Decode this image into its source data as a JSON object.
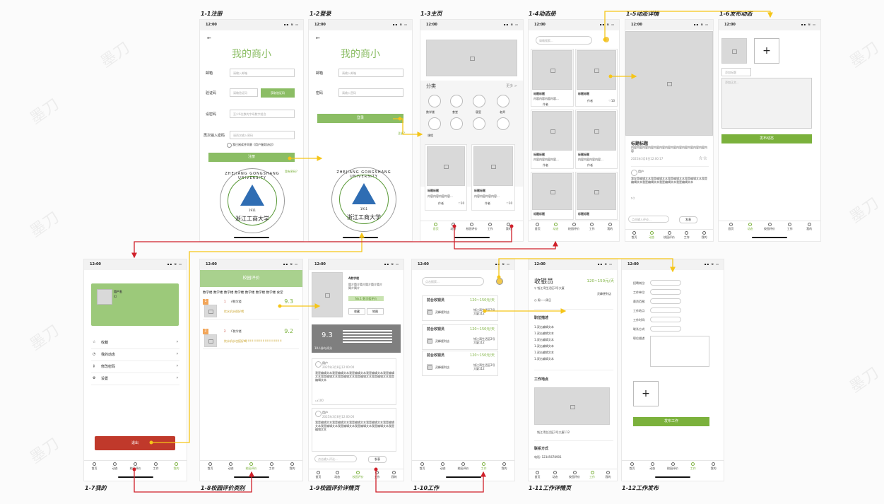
{
  "status_time": "12:00",
  "status_icons": "▪▪ ≋ ▭",
  "titles": {
    "s1": "1-1注册",
    "s2": "1-2登录",
    "s3": "1-3主页",
    "s4": "1-4动态册",
    "s5": "1-5动态详情",
    "s6": "1-6发布动态",
    "s7": "1-7我的",
    "s8": "1-8校园评价类别",
    "s9": "1-9校园评价详情页",
    "s10": "1-10工作",
    "s11": "1-11工作详情页",
    "s12": "1-12工作发布"
  },
  "tabs": [
    "首页",
    "动态",
    "校园评价",
    "工作",
    "我的"
  ],
  "register": {
    "brand": "我的商小",
    "email_label": "邮箱",
    "email_ph": "请输入邮箱",
    "code_label": "验证码",
    "code_ph": "请输验证码",
    "code_btn": "获取验证码",
    "pwd_label": "设密码",
    "pwd_ph": "至少6位数的字母数字组合",
    "repwd_label": "再次输入密码",
    "repwd_ph": "请再次输入密码",
    "agree": "我已阅读并同意《用户服务协议》",
    "submit": "注册",
    "to_login": "我有密码?"
  },
  "login": {
    "brand": "我的商小",
    "email_label": "邮箱",
    "email_ph": "请输入邮箱",
    "pwd_label": "密码",
    "pwd_ph": "请输入密码",
    "submit": "登录",
    "forgot": "注册?"
  },
  "seal": {
    "top": "ZHEJIANG GONGSHANG UNIVERSITY",
    "year": "1911",
    "name": "浙江工商大学"
  },
  "home": {
    "section": "分类",
    "more": "更多 >",
    "cats": [
      "数学楼",
      "食堂",
      "寝室",
      "老师",
      "课程"
    ],
    "post_title": "标题标题",
    "post_body": "内容内容内容内容...",
    "author": "作者",
    "likes": "10"
  },
  "feed": {
    "search_ph": "请输搜索...",
    "post_title": "标题标题",
    "post_body": "内容内容内容内容...",
    "author": "作者",
    "likes": "10"
  },
  "detail": {
    "title": "标题标题",
    "body": "内容内容内容内容内容内容内容内容内容内容内容内容内容内容",
    "date": "2025年3月8日12:00:17",
    "user": "用户",
    "comment": "我发是编辑文本我是编辑文本我是编辑文本我是编辑文本我是编辑文本我是编辑文本我是编辑文本我是编辑文本",
    "reply_ph": "点击输入评论...",
    "send": "发表"
  },
  "publish": {
    "title_ph": "添加标题",
    "body_ph": "添加正文...",
    "submit": "发布动态"
  },
  "mine": {
    "username": "用户名",
    "uid": "ID",
    "items": [
      "收藏",
      "我的动态",
      "修改密码",
      "设置"
    ],
    "logout": "退出"
  },
  "category": {
    "header": "校园评价",
    "tabs": [
      "数学楼",
      "数学楼",
      "数学楼",
      "数学楼",
      "数学楼",
      "数学楼",
      "数学楼",
      "食堂"
    ],
    "items": [
      {
        "rank": "1",
        "name": "A数学楼",
        "score": "9.3",
        "note": "饮水机水很好喝"
      },
      {
        "rank": "2",
        "name": "C数学楼",
        "score": "9.2",
        "note": "饮水机水也挺好喝!!!!!!!!!!!!!!!!!!!!!!!!!!!!!!!"
      }
    ]
  },
  "review": {
    "name": "A数学楼",
    "intro": "简介简介简介简介简介简介简介简介",
    "rank_tag": "No.1 数学楼评价",
    "collect": "收藏",
    "map": "地图",
    "score": "9.3",
    "count": "10人参与评分",
    "users": [
      "用户",
      "用户"
    ],
    "date": "2025年3月8日12:00:00",
    "text": "我是编辑文本我是编辑文本我是编辑文本我是编辑文本我是编辑文本我是编辑文本我是编辑文本我是编辑文本我是编辑文本我是编辑文本",
    "likes": "100",
    "reply_ph": "点击输入评论...",
    "send": "发表"
  },
  "jobs": {
    "search_ph": "点击搜索...",
    "list": [
      {
        "title": "前台收银员",
        "pay": "120~150元/天",
        "shop": "灵峰便利店",
        "addr": "钱江湾生活区2号大厦112"
      },
      {
        "title": "前台收银员",
        "pay": "120~150元/天",
        "shop": "灵峰便利店",
        "addr": "钱江湾生活区2号大厦112"
      },
      {
        "title": "前台收银员",
        "pay": "120~150元/天",
        "shop": "灵峰便利店",
        "addr": "钱江湾生活区2号大厦112"
      }
    ]
  },
  "job_detail": {
    "title": "收银员",
    "pay": "120~150元/天",
    "addr": "钱江湾生活区2号大厦",
    "time": "周一~周日",
    "shop": "灵峰便利店",
    "desc_h": "职位描述",
    "desc": [
      "1.双击编辑文本",
      "1.双击编辑文本",
      "1.双击编辑文本",
      "1.双击编辑文本",
      "1.双击编辑文本",
      "1.双击编辑文本"
    ],
    "place_h": "工作地点",
    "place_addr": "钱江湾生活区2号大厦112",
    "contact_h": "联系方式",
    "phone": "电话: 12345678901"
  },
  "job_publish": {
    "fields": [
      "招聘岗位:",
      "工作单位:",
      "薪资范围:",
      "工作地点:",
      "工作时间:",
      "联系方式:",
      "职位描述:"
    ],
    "submit": "发布工作"
  },
  "watermark": "墨刀"
}
